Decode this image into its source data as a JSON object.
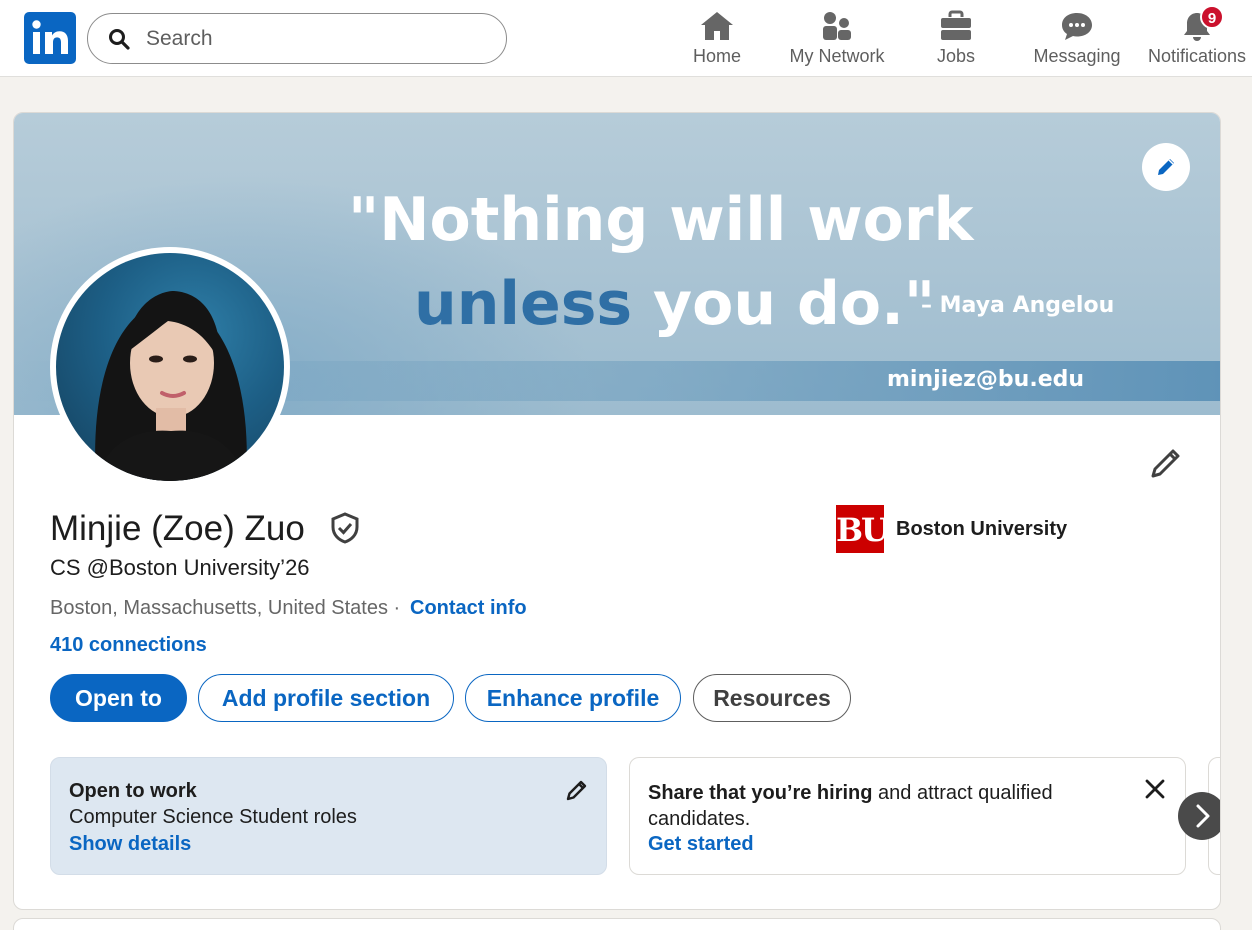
{
  "nav": {
    "search_placeholder": "Search",
    "items": [
      {
        "label": "Home",
        "icon": "home-icon"
      },
      {
        "label": "My Network",
        "icon": "people-icon"
      },
      {
        "label": "Jobs",
        "icon": "briefcase-icon"
      },
      {
        "label": "Messaging",
        "icon": "chat-icon"
      },
      {
        "label": "Notifications",
        "icon": "bell-icon",
        "badge": "9"
      }
    ]
  },
  "banner": {
    "quote_line1": "\"Nothing will work",
    "quote_line2_blue": "unless",
    "quote_line2_rest": " you do.\"",
    "author": "– Maya Angelou",
    "email": "minjiez@bu.edu"
  },
  "profile": {
    "name": "Minjie (Zoe) Zuo",
    "headline": "CS @Boston University’26",
    "location": "Boston, Massachusetts, United States ·",
    "contact_label": "Contact info",
    "connections": "410 connections",
    "school": {
      "logo_text": "BU",
      "name": "Boston University"
    }
  },
  "actions": {
    "open_to": "Open to",
    "add_section": "Add profile section",
    "enhance": "Enhance profile",
    "resources": "Resources"
  },
  "open_to_work": {
    "title": "Open to work",
    "roles": "Computer Science Student roles",
    "link": "Show details"
  },
  "hiring": {
    "bold": "Share that you’re hiring",
    "rest": " and attract qualified candidates.",
    "link": "Get started"
  },
  "colors": {
    "brand": "#0a66c2",
    "badge": "#cb112d",
    "bu_red": "#cc0000"
  }
}
